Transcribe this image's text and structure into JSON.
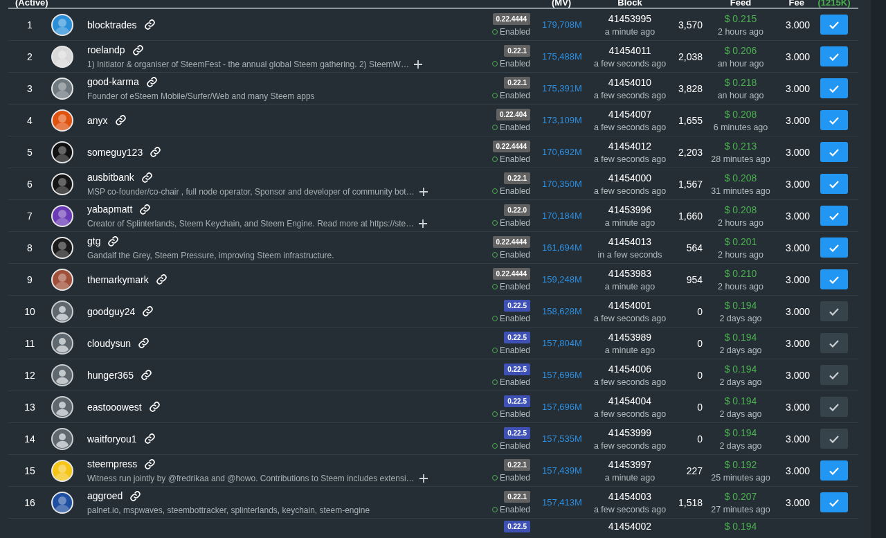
{
  "table": {
    "columns": [
      "(Active)",
      "(MV)",
      "Block",
      "Feed",
      "Fee",
      "(1215K)"
    ],
    "rows": [
      {
        "rank": "1",
        "name": "blocktrades",
        "version": {
          "label": "0.22.4444",
          "color": "#616161"
        },
        "status": "Enabled",
        "enabled": true,
        "votes": "179,708M",
        "block": "41453995",
        "block_time": "a minute ago",
        "missed": "3,570",
        "feed": "$ 0.215",
        "feed_time": "2 hours ago",
        "fee": "3.000",
        "voted": true
      },
      {
        "rank": "2",
        "name": "roelandp",
        "description": "1) Initiator & organiser of SteemFest - the annual global Steem gathering. 2) SteemW…",
        "expandable": true,
        "version": {
          "label": "0.22.1",
          "color": "#616161"
        },
        "status": "Enabled",
        "enabled": true,
        "votes": "175,488M",
        "block": "41454011",
        "block_time": "a few seconds ago",
        "missed": "2,038",
        "feed": "$ 0.206",
        "feed_time": "an hour ago",
        "fee": "3.000",
        "voted": true
      },
      {
        "rank": "3",
        "name": "good-karma",
        "description": "Founder of eSteem Mobile/Surfer/Web and many Steem apps",
        "expandable": false,
        "version": {
          "label": "0.22.1",
          "color": "#616161"
        },
        "status": "Enabled",
        "enabled": true,
        "votes": "175,391M",
        "block": "41454010",
        "block_time": "a few seconds ago",
        "missed": "3,828",
        "feed": "$ 0.218",
        "feed_time": "an hour ago",
        "fee": "3.000",
        "voted": true
      },
      {
        "rank": "4",
        "name": "anyx",
        "version": {
          "label": "0.22.404",
          "color": "#616161"
        },
        "status": "Enabled",
        "enabled": true,
        "votes": "173,109M",
        "block": "41454007",
        "block_time": "a few seconds ago",
        "missed": "1,655",
        "feed": "$ 0.208",
        "feed_time": "6 minutes ago",
        "fee": "3.000",
        "voted": true
      },
      {
        "rank": "5",
        "name": "someguy123",
        "version": {
          "label": "0.22.4444",
          "color": "#616161"
        },
        "status": "Enabled",
        "enabled": true,
        "votes": "170,692M",
        "block": "41454012",
        "block_time": "a few seconds ago",
        "missed": "2,203",
        "feed": "$ 0.213",
        "feed_time": "28 minutes ago",
        "fee": "3.000",
        "voted": true
      },
      {
        "rank": "6",
        "name": "ausbitbank",
        "description": "MSP co-founder/co-chair , full node operator, Sponsor and developer of community bot…",
        "expandable": true,
        "version": {
          "label": "0.22.1",
          "color": "#616161"
        },
        "status": "Enabled",
        "enabled": true,
        "votes": "170,350M",
        "block": "41454000",
        "block_time": "a few seconds ago",
        "missed": "1,567",
        "feed": "$ 0.208",
        "feed_time": "31 minutes ago",
        "fee": "3.000",
        "voted": true
      },
      {
        "rank": "7",
        "name": "yabapmatt",
        "description": "Creator of Splinterlands, Steem Keychain, and Steem Engine. Read more at https://ste…",
        "expandable": true,
        "version": {
          "label": "0.22.0",
          "color": "#616161"
        },
        "status": "Enabled",
        "enabled": true,
        "votes": "170,184M",
        "block": "41453996",
        "block_time": "a minute ago",
        "missed": "1,660",
        "feed": "$ 0.208",
        "feed_time": "2 hours ago",
        "fee": "3.000",
        "voted": true
      },
      {
        "rank": "8",
        "name": "gtg",
        "description": "Gandalf the Grey, Steem Pressure, improving Steem infrastructure.",
        "expandable": false,
        "version": {
          "label": "0.22.4444",
          "color": "#616161"
        },
        "status": "Enabled",
        "enabled": true,
        "votes": "161,694M",
        "block": "41454013",
        "block_time": "in a few seconds",
        "missed": "564",
        "feed": "$ 0.201",
        "feed_time": "2 hours ago",
        "fee": "3.000",
        "voted": true
      },
      {
        "rank": "9",
        "name": "themarkymark",
        "version": {
          "label": "0.22.4444",
          "color": "#616161"
        },
        "status": "Enabled",
        "enabled": true,
        "votes": "159,248M",
        "block": "41453983",
        "block_time": "a minute ago",
        "missed": "954",
        "feed": "$ 0.210",
        "feed_time": "2 hours ago",
        "fee": "3.000",
        "voted": true
      },
      {
        "rank": "10",
        "avatar": {
          "kind": "default"
        },
        "name": "goodguy24",
        "version": {
          "label": "0.22.5",
          "color": "#3f51b5"
        },
        "status": "Enabled",
        "enabled": true,
        "votes": "158,628M",
        "block": "41454001",
        "block_time": "a few seconds ago",
        "missed": "0",
        "feed": "$ 0.194",
        "feed_time": "2 days ago",
        "fee": "3.000",
        "voted": false
      },
      {
        "rank": "11",
        "avatar": {
          "kind": "default"
        },
        "name": "cloudysun",
        "version": {
          "label": "0.22.5",
          "color": "#3f51b5"
        },
        "status": "Enabled",
        "enabled": true,
        "votes": "157,804M",
        "block": "41453989",
        "block_time": "a minute ago",
        "missed": "0",
        "feed": "$ 0.194",
        "feed_time": "2 days ago",
        "fee": "3.000",
        "voted": false
      },
      {
        "rank": "12",
        "avatar": {
          "kind": "default"
        },
        "name": "hunger365",
        "version": {
          "label": "0.22.5",
          "color": "#3f51b5"
        },
        "status": "Enabled",
        "enabled": true,
        "votes": "157,696M",
        "block": "41454006",
        "block_time": "a few seconds ago",
        "missed": "0",
        "feed": "$ 0.194",
        "feed_time": "2 days ago",
        "fee": "3.000",
        "voted": false
      },
      {
        "rank": "13",
        "avatar": {
          "kind": "default"
        },
        "name": "eastooowest",
        "version": {
          "label": "0.22.5",
          "color": "#3f51b5"
        },
        "status": "Enabled",
        "enabled": true,
        "votes": "157,696M",
        "block": "41454004",
        "block_time": "a few seconds ago",
        "missed": "0",
        "feed": "$ 0.194",
        "feed_time": "2 days ago",
        "fee": "3.000",
        "voted": false
      },
      {
        "rank": "14",
        "avatar": {
          "kind": "default"
        },
        "name": "waitforyou1",
        "version": {
          "label": "0.22.5",
          "color": "#3f51b5"
        },
        "status": "Enabled",
        "enabled": true,
        "votes": "157,535M",
        "block": "41453999",
        "block_time": "a few seconds ago",
        "missed": "0",
        "feed": "$ 0.194",
        "feed_time": "2 days ago",
        "fee": "3.000",
        "voted": false
      },
      {
        "rank": "15",
        "name": "steempress",
        "description": "Witness run jointly by @fredrikaa and @howo. Contributions to Steem includes extensi…",
        "expandable": true,
        "version": {
          "label": "0.22.1",
          "color": "#616161"
        },
        "status": "Enabled",
        "enabled": true,
        "votes": "157,439M",
        "block": "41453997",
        "block_time": "a minute ago",
        "missed": "227",
        "feed": "$ 0.192",
        "feed_time": "25 minutes ago",
        "fee": "3.000",
        "voted": true
      },
      {
        "rank": "16",
        "name": "aggroed",
        "description": "palnet.io, mspwaves, steembottracker, splinterlands, keychain, steem-engine",
        "expandable": false,
        "version": {
          "label": "0.22.1",
          "color": "#616161"
        },
        "status": "Enabled",
        "enabled": true,
        "votes": "157,413M",
        "block": "41454003",
        "block_time": "a few seconds ago",
        "missed": "1,518",
        "feed": "$ 0.207",
        "feed_time": "27 minutes ago",
        "fee": "3.000",
        "voted": true
      },
      {
        "version": {
          "label": "0.22.5",
          "color": "#3f51b5"
        },
        "block": "41454002",
        "feed": "$ 0.194"
      }
    ]
  }
}
